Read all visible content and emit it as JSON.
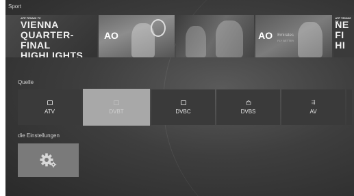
{
  "sport": {
    "title": "Sport",
    "banner": {
      "tile1": {
        "small": "ATP TENNIS TV",
        "headline": [
          "VIENNA",
          "QUARTER-FINAL",
          "HIGHLIGHTS"
        ]
      },
      "tile2": {
        "logo": "AO"
      },
      "tile4": {
        "logo": "AO",
        "sponsor": "Emirates",
        "sponsor_sub": "FLY BETTER"
      },
      "tile5": {
        "small": "ATP TENNIS TV",
        "headline": [
          "NE",
          "FI",
          "HI"
        ]
      }
    }
  },
  "source": {
    "title": "Quelle",
    "items": [
      {
        "label": "ATV",
        "icon": "tv-icon"
      },
      {
        "label": "DVBT",
        "icon": "tv-icon",
        "selected": true
      },
      {
        "label": "DVBC",
        "icon": "tv-icon"
      },
      {
        "label": "DVBS",
        "icon": "satellite-icon"
      },
      {
        "label": "AV",
        "icon": "av-input-icon"
      }
    ]
  },
  "settings": {
    "title": "die Einstellungen",
    "icon": "gear-icon"
  }
}
